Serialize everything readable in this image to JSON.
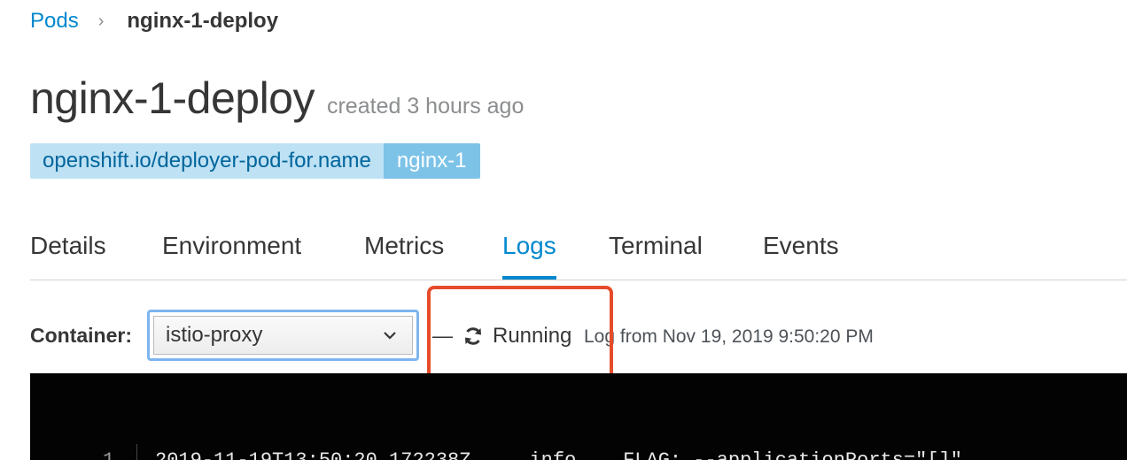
{
  "breadcrumb": {
    "parent": "Pods",
    "separator": "›",
    "current": "nginx-1-deploy"
  },
  "header": {
    "title": "nginx-1-deploy",
    "subtitle": "created 3 hours ago"
  },
  "label": {
    "key": "openshift.io/deployer-pod-for.name",
    "value": "nginx-1"
  },
  "tabs": [
    {
      "label": "Details"
    },
    {
      "label": "Environment"
    },
    {
      "label": "Metrics"
    },
    {
      "label": "Logs",
      "active": true
    },
    {
      "label": "Terminal"
    },
    {
      "label": "Events"
    }
  ],
  "logs": {
    "container_label": "Container:",
    "container_selected": "istio-proxy",
    "dash": "—",
    "status": "Running",
    "log_from": "Log from Nov 19, 2019 9:50:20 PM",
    "lines": [
      {
        "num": "1",
        "text": "2019-11-19T13:50:20.172238Z     info    FLAG: --applicationPorts=\"[]\""
      }
    ]
  },
  "icons": {
    "separator": "chevron-right-icon",
    "dropdown": "chevron-down-icon",
    "status": "sync-icon"
  },
  "colors": {
    "link": "#0088ce",
    "label_key_bg": "#bee1f4",
    "label_value_bg": "#7dc3e8",
    "highlight": "#e64c2a",
    "log_bg": "#030303"
  }
}
